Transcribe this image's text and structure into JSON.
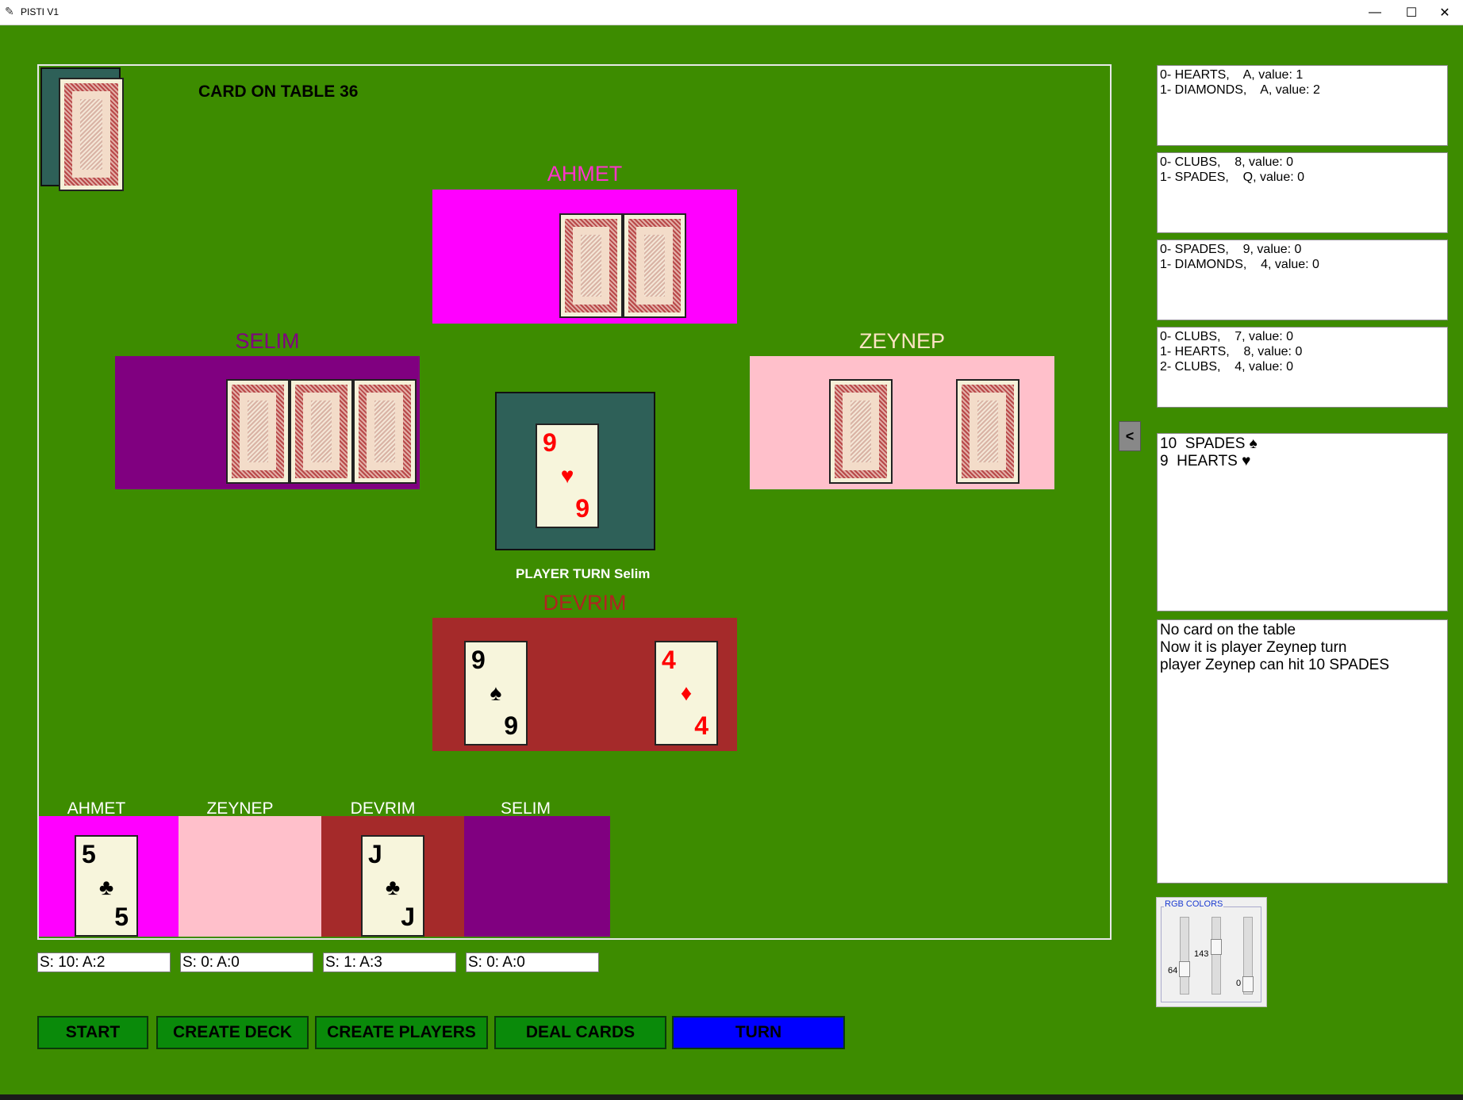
{
  "window": {
    "title": "PISTI V1",
    "minimize": "—",
    "maximize": "☐",
    "close": "✕"
  },
  "table": {
    "card_on_table": "CARD ON TABLE 36",
    "player_turn": "PLAYER TURN Selim",
    "center_card": {
      "rank": "9",
      "suit": "♥",
      "color": "#ff0000"
    }
  },
  "players": {
    "ahmet": {
      "name": "AHMET",
      "color": "#ff00ff",
      "name_color": "#ff33cc"
    },
    "selim": {
      "name": "SELIM",
      "color": "#800080",
      "name_color": "#800080"
    },
    "zeynep": {
      "name": "ZEYNEP",
      "color": "#ffc0cb",
      "name_color": "#ffe4c4"
    },
    "devrim": {
      "name": "DEVRIM",
      "color": "#a52a2a",
      "name_color": "#b22222",
      "cards": [
        {
          "rank": "9",
          "suit": "♠",
          "color": "#000000"
        },
        {
          "rank": "4",
          "suit": "♦",
          "color": "#ff0000"
        }
      ]
    }
  },
  "trays": [
    {
      "label": "AHMET",
      "color": "#ff00ff",
      "card": {
        "rank": "5",
        "suit": "♣"
      },
      "score": "S: 10: A:2"
    },
    {
      "label": "ZEYNEP",
      "color": "#ffc0cb",
      "card": null,
      "score": "S: 0: A:0"
    },
    {
      "label": "DEVRIM",
      "color": "#a52a2a",
      "card": {
        "rank": "J",
        "suit": "♣"
      },
      "score": "S: 1: A:3"
    },
    {
      "label": "SELIM",
      "color": "#800080",
      "card": null,
      "score": "S: 0: A:0"
    }
  ],
  "buttons": {
    "start": "START",
    "create_deck": "CREATE DECK",
    "create_players": "CREATE PLAYERS",
    "deal_cards": "DEAL CARDS",
    "turn": "TURN"
  },
  "right_panel": {
    "collapse": "<",
    "hand_logs": [
      "0- HEARTS,    A, value: 1\n1- DIAMONDS,    A, value: 2",
      "0- CLUBS,    8, value: 0\n1- SPADES,    Q, value: 0",
      "0- SPADES,    9, value: 0\n1- DIAMONDS,    4, value: 0",
      "0- CLUBS,    7, value: 0\n1- HEARTS,    8, value: 0\n2- CLUBS,    4, value: 0"
    ],
    "pile_log": "10  SPADES ♠\n9  HEARTS ♥",
    "message_log": "No card on the table\nNow it is player Zeynep turn\nplayer Zeynep can hit 10 SPADES",
    "rgb": {
      "label": "RGB COLORS",
      "r": "64",
      "g": "143",
      "b": "0"
    }
  }
}
